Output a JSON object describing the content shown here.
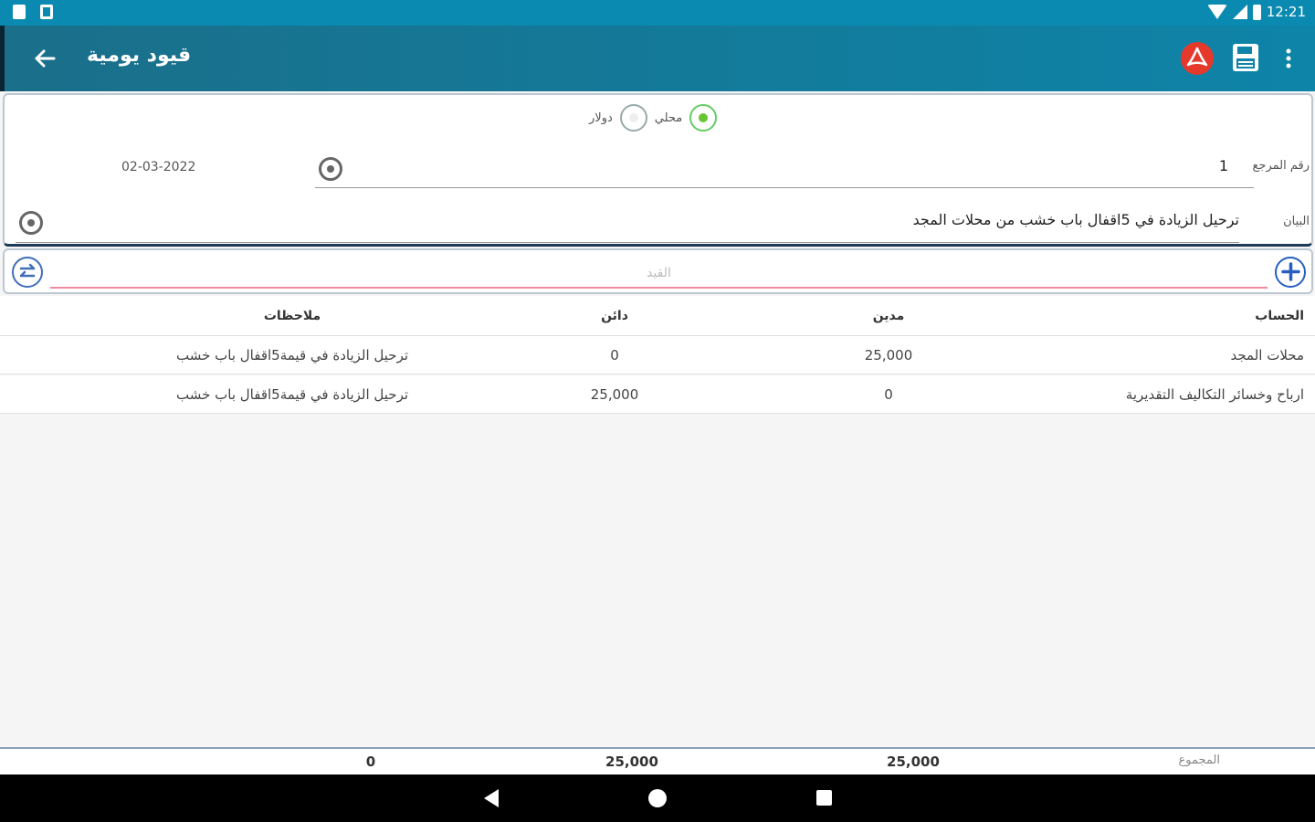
{
  "status_bar": {
    "time": "12:21"
  },
  "app_bar": {
    "title": "قيود يومية",
    "back_icon": "arrow-back-icon",
    "pdf_icon": "pdf-icon",
    "save_icon": "save-icon",
    "more_icon": "more-vert-icon"
  },
  "currency": {
    "options": [
      {
        "label": "محلي",
        "selected": true
      },
      {
        "label": "دولار",
        "selected": false
      }
    ]
  },
  "form": {
    "ref_label": "رقم المرجع",
    "ref_value": "1",
    "date": "02-03-2022",
    "desc_label": "البيان",
    "desc_value": "ترحيل الزيادة في 5اقفال باب خشب من محلات المجد"
  },
  "entry": {
    "placeholder": "القيد"
  },
  "table": {
    "headers": {
      "account": "الحساب",
      "debit": "مدين",
      "credit": "دائن",
      "notes": "ملاحظات"
    },
    "rows": [
      {
        "account": "محلات المجد",
        "debit": "25,000",
        "credit": "0",
        "notes": "ترحيل الزيادة في قيمة5اقفال باب خشب"
      },
      {
        "account": "ارباح وخسائر التكاليف التقديرية",
        "debit": "0",
        "credit": "25,000",
        "notes": "ترحيل الزيادة في قيمة5اقفال باب خشب"
      }
    ]
  },
  "totals": {
    "label": "المجموع",
    "debit": "25,000",
    "credit": "25,000",
    "notes": "0"
  },
  "colors": {
    "appbar": "#0e84a8",
    "statusbar": "#0a8ab0",
    "radio_selected": "#6ac534",
    "add_button": "#2760c0"
  }
}
